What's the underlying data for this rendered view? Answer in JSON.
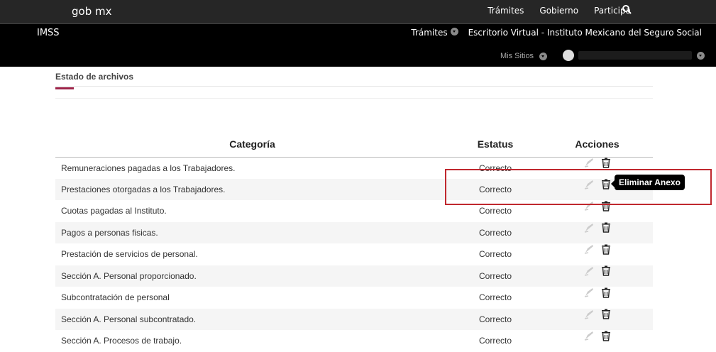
{
  "header": {
    "logo": "gob mx",
    "nav": [
      "Trámites",
      "Gobierno",
      "Participa"
    ]
  },
  "subheader": {
    "title": "IMSS",
    "tramites": "Trámites",
    "escritorio": "Escritorio Virtual - Instituto Mexicano del Seguro Social",
    "mis_sitios": "Mis Sitios"
  },
  "section": {
    "title": "Estado de archivos"
  },
  "table": {
    "headers": [
      "Categoría",
      "Estatus",
      "Acciones"
    ],
    "rows": [
      {
        "cat": "Remuneraciones pagadas a los Trabajadores.",
        "status": "Correcto"
      },
      {
        "cat": "Prestaciones otorgadas a los Trabajadores.",
        "status": "Correcto"
      },
      {
        "cat": "Cuotas pagadas al Instituto.",
        "status": "Correcto"
      },
      {
        "cat": "Pagos a personas fisicas.",
        "status": "Correcto"
      },
      {
        "cat": "Prestación de servicios de personal.",
        "status": "Correcto"
      },
      {
        "cat": "Sección A. Personal proporcionado.",
        "status": "Correcto"
      },
      {
        "cat": "Subcontratación de personal",
        "status": "Correcto"
      },
      {
        "cat": "Sección A. Personal subcontratado.",
        "status": "Correcto"
      },
      {
        "cat": "Sección A. Procesos de trabajo.",
        "status": "Correcto"
      }
    ]
  },
  "tooltip": "Eliminar Anexo",
  "colors": {
    "accent": "#9d2449",
    "highlight": "#c0282e"
  }
}
